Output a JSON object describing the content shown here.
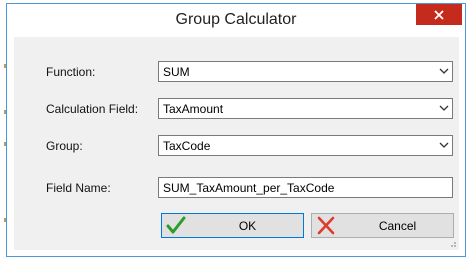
{
  "window": {
    "title": "Group Calculator",
    "close_icon": "close-icon"
  },
  "form": {
    "function": {
      "label": "Function:",
      "value": "SUM"
    },
    "calculation_field": {
      "label": "Calculation Field:",
      "value": "TaxAmount"
    },
    "group": {
      "label": "Group:",
      "value": "TaxCode"
    },
    "field_name": {
      "label": "Field Name:",
      "value": "SUM_TaxAmount_per_TaxCode"
    }
  },
  "buttons": {
    "ok": {
      "label": "OK",
      "icon": "checkmark-icon",
      "color": "#2a9d2a"
    },
    "cancel": {
      "label": "Cancel",
      "icon": "x-icon",
      "color": "#e03a2e"
    }
  }
}
